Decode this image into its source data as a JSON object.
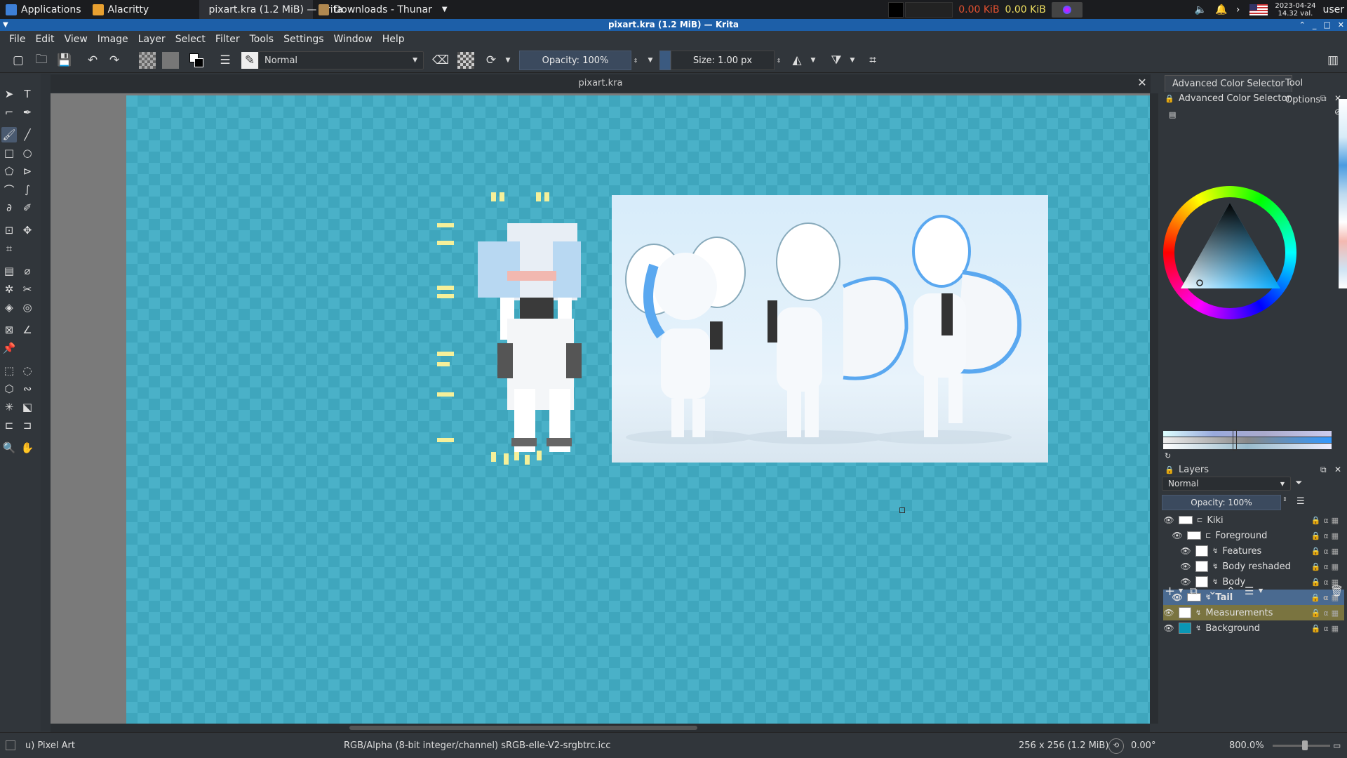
{
  "taskbar": {
    "applications": "Applications",
    "task1": "Alacritty",
    "task2": "pixart.kra (1.2 MiB) — Krita",
    "task3": "Downloads - Thunar",
    "net_down": "0.00 KiB",
    "net_up": "0.00 KiB",
    "date": "2023-04-24",
    "time": "14.32 val.",
    "user": "user",
    "colors": {
      "bg": "#1b1c1f",
      "net_down": "#e05030",
      "net_up": "#f0e060"
    }
  },
  "window": {
    "title": "pixart.kra (1.2 MiB) — Krita",
    "title_bg": "#1d5fa8"
  },
  "menu": [
    "File",
    "Edit",
    "View",
    "Image",
    "Layer",
    "Select",
    "Filter",
    "Tools",
    "Settings",
    "Window",
    "Help"
  ],
  "toolbar": {
    "blend_mode": "Normal",
    "opacity": "Opacity: 100%",
    "size": "Size: 1.00 px"
  },
  "document": {
    "tab_title": "pixart.kra"
  },
  "dockers": {
    "tabs": [
      "Advanced Color Selector",
      "Tool Options"
    ],
    "color_selector_title": "Advanced Color Selector",
    "layers_title": "Layers",
    "layers_blend": "Normal",
    "layers_opacity": "Opacity:  100%",
    "layers": [
      {
        "name": "Kiki",
        "indent": 0
      },
      {
        "name": "Foreground",
        "indent": 1
      },
      {
        "name": "Features",
        "indent": 2
      },
      {
        "name": "Body reshaded",
        "indent": 2
      },
      {
        "name": "Body",
        "indent": 2
      },
      {
        "name": "Tail",
        "indent": 1,
        "selected": true
      },
      {
        "name": "Measurements",
        "indent": 0,
        "highlight": true
      },
      {
        "name": "Background",
        "indent": 0,
        "thumb_color": "#0a97b5"
      }
    ]
  },
  "status": {
    "brush": "u) Pixel Art",
    "color_model": "RGB/Alpha (8-bit integer/channel)  sRGB-elle-V2-srgbtrc.icc",
    "image_size": "256 x 256 (1.2 MiB)",
    "rotation": "0.00°",
    "zoom": "800.0%"
  },
  "icons": [
    "pointer-icon",
    "text-icon",
    "brush-icon",
    "line-icon",
    "rect-icon",
    "ellipse-icon",
    "polygon-icon",
    "polyline-icon",
    "bezier-icon",
    "freehand-path-icon",
    "dynamic-brush-icon",
    "multibrush-icon",
    "transform-icon",
    "move-icon",
    "crop-icon",
    "gradient-icon",
    "color-picker-icon",
    "smart-patch-icon",
    "fill-icon",
    "assistant-icon",
    "measure-icon",
    "reference-icon",
    "select-rect-icon",
    "select-ellipse-icon",
    "select-poly-icon",
    "select-free-icon",
    "magic-wand-icon",
    "select-similar-icon",
    "select-bezier-icon",
    "select-magnetic-icon",
    "zoom-icon",
    "pan-icon"
  ],
  "accent": {
    "canvas": "#4ab1c8",
    "layer_selected": "#4a6a90",
    "layer_highlight": "#7a7440",
    "slider": "#3b4a5e"
  }
}
